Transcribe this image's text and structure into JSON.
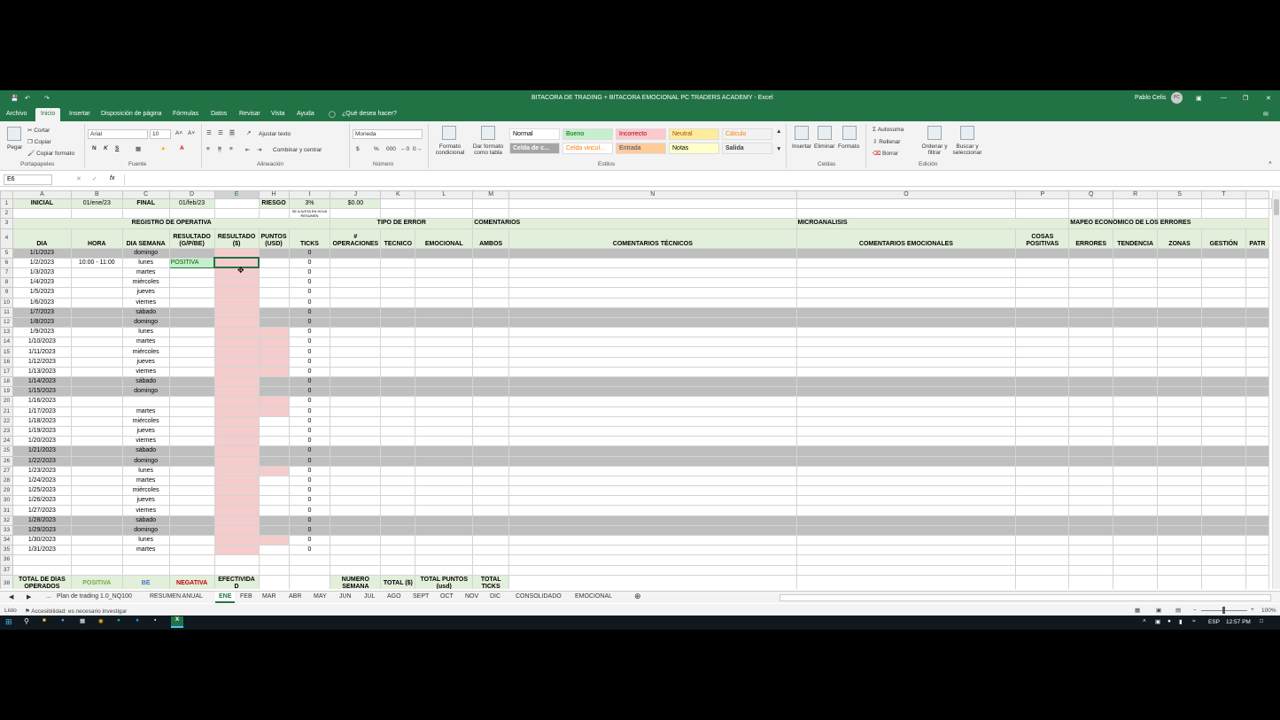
{
  "window": {
    "title": "BITACORA DE TRADING + BITACORA EMOCIONAL PC TRADERS ACADEMY - Excel",
    "user": "Pablo Celis",
    "user_initials": "PC"
  },
  "menu": [
    "Archivo",
    "Inicio",
    "Insertar",
    "Disposición de página",
    "Fórmulas",
    "Datos",
    "Revisar",
    "Vista",
    "Ayuda",
    "¿Qué desea hacer?"
  ],
  "ribbon": {
    "clipboard": {
      "paste": "Pegar",
      "cut": "Cortar",
      "copy": "Copiar",
      "format_painter": "Copiar formato",
      "label": "Portapapeles"
    },
    "font": {
      "name": "Arial",
      "size": "10",
      "bold": "N",
      "italic": "K",
      "underline": "S",
      "label": "Fuente"
    },
    "alignment": {
      "wrap": "Ajustar texto",
      "merge": "Combinar y centrar",
      "label": "Alineación"
    },
    "number": {
      "format": "Moneda",
      "label": "Número"
    },
    "styles": {
      "conditional": "Formato condicional",
      "table": "Dar formato como tabla",
      "label": "Estilos",
      "cells": [
        {
          "name": "Normal",
          "bg": "#ffffff",
          "fg": "#000000"
        },
        {
          "name": "Bueno",
          "bg": "#c6efce",
          "fg": "#006100"
        },
        {
          "name": "Incorrecto",
          "bg": "#ffc7ce",
          "fg": "#9c0006"
        },
        {
          "name": "Neutral",
          "bg": "#ffeb9c",
          "fg": "#9c5700"
        },
        {
          "name": "Cálculo",
          "bg": "#f2f2f2",
          "fg": "#fa7d00"
        },
        {
          "name": "Celda de c...",
          "bg": "#a5a5a5",
          "fg": "#ffffff"
        },
        {
          "name": "Celda vincul...",
          "bg": "#ffffff",
          "fg": "#fa7d00"
        },
        {
          "name": "Entrada",
          "bg": "#ffcc99",
          "fg": "#3f3f76"
        },
        {
          "name": "Notas",
          "bg": "#ffffcc",
          "fg": "#000000"
        },
        {
          "name": "Salida",
          "bg": "#f2f2f2",
          "fg": "#3f3f3f"
        }
      ]
    },
    "cells": {
      "insert": "Insertar",
      "delete": "Eliminar",
      "format": "Formato",
      "label": "Celdas"
    },
    "editing": {
      "autosum": "Autosuma",
      "fill": "Rellenar",
      "clear": "Borrar",
      "sort": "Ordenar y filtrar",
      "find": "Buscar y seleccionar",
      "label": "Edición"
    }
  },
  "namebox": "E6",
  "fx": "fx",
  "columns": [
    "A",
    "B",
    "C",
    "D",
    "E",
    "H",
    "I",
    "J",
    "K",
    "L",
    "M",
    "N",
    "O",
    "P",
    "Q",
    "R",
    "S",
    "T"
  ],
  "row1": {
    "inicial": "INICIAL",
    "inicial_val": "01/ene/23",
    "final": "FINAL",
    "final_val": "01/feb/23",
    "riesgo": "RIESGO",
    "riesgo_val": "3%",
    "riesgo_note": "SE AJUSTA EN HOJA RESUMEN",
    "capital": "$0.00"
  },
  "row3": {
    "registro": "REGISTRO DE OPERATIVA",
    "tipo_error": "TIPO DE ERROR",
    "comentarios": "COMENTARIOS",
    "micro": "MICROANALISIS",
    "mapeo": "MAPEO ECONÓMICO DE LOS ERRORES"
  },
  "headers": [
    "DIA",
    "HORA",
    "DIA SEMANA",
    "RESULTADO (G/P/BE)",
    "RESULTADO ($)",
    "PUNTOS (USD)",
    "TICKS",
    "# OPERACIONES",
    "TECNICO",
    "EMOCIONAL",
    "AMBOS",
    "COMENTARIOS TÉCNICOS",
    "COMENTARIOS EMOCIONALES",
    "COSAS POSITIVAS",
    "ERRORES",
    "TENDENCIA",
    "ZONAS",
    "GESTIÓN",
    "PATR"
  ],
  "rows": [
    {
      "n": "5",
      "date": "1/1/2023",
      "hora": "",
      "dia": "domingo",
      "res": "",
      "ticks": "0",
      "weekend": true
    },
    {
      "n": "6",
      "date": "1/2/2023",
      "hora": "10:00 - 11:00",
      "dia": "lunes",
      "res": "POSITIVA",
      "ticks": "0",
      "weekend": false
    },
    {
      "n": "7",
      "date": "1/3/2023",
      "hora": "",
      "dia": "martes",
      "res": "",
      "ticks": "0",
      "weekend": false
    },
    {
      "n": "8",
      "date": "1/4/2023",
      "hora": "",
      "dia": "miércoles",
      "res": "",
      "ticks": "0",
      "weekend": false
    },
    {
      "n": "9",
      "date": "1/5/2023",
      "hora": "",
      "dia": "jueves",
      "res": "",
      "ticks": "0",
      "weekend": false
    },
    {
      "n": "10",
      "date": "1/6/2023",
      "hora": "",
      "dia": "viernes",
      "res": "",
      "ticks": "0",
      "weekend": false
    },
    {
      "n": "11",
      "date": "1/7/2023",
      "hora": "",
      "dia": "sábado",
      "res": "",
      "ticks": "0",
      "weekend": true
    },
    {
      "n": "12",
      "date": "1/8/2023",
      "hora": "",
      "dia": "domingo",
      "res": "",
      "ticks": "0",
      "weekend": true
    },
    {
      "n": "13",
      "date": "1/9/2023",
      "hora": "",
      "dia": "lunes",
      "res": "",
      "ticks": "0",
      "weekend": false
    },
    {
      "n": "14",
      "date": "1/10/2023",
      "hora": "",
      "dia": "martes",
      "res": "",
      "ticks": "0",
      "weekend": false
    },
    {
      "n": "15",
      "date": "1/11/2023",
      "hora": "",
      "dia": "miércoles",
      "res": "",
      "ticks": "0",
      "weekend": false
    },
    {
      "n": "16",
      "date": "1/12/2023",
      "hora": "",
      "dia": "jueves",
      "res": "",
      "ticks": "0",
      "weekend": false
    },
    {
      "n": "17",
      "date": "1/13/2023",
      "hora": "",
      "dia": "viernes",
      "res": "",
      "ticks": "0",
      "weekend": false
    },
    {
      "n": "18",
      "date": "1/14/2023",
      "hora": "",
      "dia": "sábado",
      "res": "",
      "ticks": "0",
      "weekend": true
    },
    {
      "n": "19",
      "date": "1/15/2023",
      "hora": "",
      "dia": "domingo",
      "res": "",
      "ticks": "0",
      "weekend": true
    },
    {
      "n": "20",
      "date": "1/16/2023",
      "hora": "",
      "dia": "",
      "res": "",
      "ticks": "0",
      "weekend": false
    },
    {
      "n": "21",
      "date": "1/17/2023",
      "hora": "",
      "dia": "martes",
      "res": "",
      "ticks": "0",
      "weekend": false
    },
    {
      "n": "22",
      "date": "1/18/2023",
      "hora": "",
      "dia": "miércoles",
      "res": "",
      "ticks": "0",
      "weekend": false
    },
    {
      "n": "23",
      "date": "1/19/2023",
      "hora": "",
      "dia": "jueves",
      "res": "",
      "ticks": "0",
      "weekend": false
    },
    {
      "n": "24",
      "date": "1/20/2023",
      "hora": "",
      "dia": "viernes",
      "res": "",
      "ticks": "0",
      "weekend": false
    },
    {
      "n": "25",
      "date": "1/21/2023",
      "hora": "",
      "dia": "sábado",
      "res": "",
      "ticks": "0",
      "weekend": true
    },
    {
      "n": "26",
      "date": "1/22/2023",
      "hora": "",
      "dia": "domingo",
      "res": "",
      "ticks": "0",
      "weekend": true
    },
    {
      "n": "27",
      "date": "1/23/2023",
      "hora": "",
      "dia": "lunes",
      "res": "",
      "ticks": "0",
      "weekend": false
    },
    {
      "n": "28",
      "date": "1/24/2023",
      "hora": "",
      "dia": "martes",
      "res": "",
      "ticks": "0",
      "weekend": false
    },
    {
      "n": "29",
      "date": "1/25/2023",
      "hora": "",
      "dia": "miércoles",
      "res": "",
      "ticks": "0",
      "weekend": false
    },
    {
      "n": "30",
      "date": "1/26/2023",
      "hora": "",
      "dia": "jueves",
      "res": "",
      "ticks": "0",
      "weekend": false
    },
    {
      "n": "31",
      "date": "1/27/2023",
      "hora": "",
      "dia": "viernes",
      "res": "",
      "ticks": "0",
      "weekend": false
    },
    {
      "n": "32",
      "date": "1/28/2023",
      "hora": "",
      "dia": "sábado",
      "res": "",
      "ticks": "0",
      "weekend": true
    },
    {
      "n": "33",
      "date": "1/29/2023",
      "hora": "",
      "dia": "domingo",
      "res": "",
      "ticks": "0",
      "weekend": true
    },
    {
      "n": "34",
      "date": "1/30/2023",
      "hora": "",
      "dia": "lunes",
      "res": "",
      "ticks": "0",
      "weekend": false
    },
    {
      "n": "35",
      "date": "1/31/2023",
      "hora": "",
      "dia": "martes",
      "res": "",
      "ticks": "0",
      "weekend": false
    }
  ],
  "summary": {
    "total_dias": "TOTAL DE DÍAS OPERADOS",
    "positiva": "POSITIVA",
    "be": "BE",
    "negativa": "NEGATIVA",
    "efectividad": "EFECTIVIDA D",
    "numero_semana": "NÚMERO SEMANA",
    "total_usd": "TOTAL ($)",
    "total_puntos": "TOTAL PUNTOS (usd)",
    "total_ticks": "TOTAL TICKS"
  },
  "sheets": [
    "Plan de trading 1.0_NQ100",
    "RESUMEN ANUAL",
    "ENE",
    "FEB",
    "MAR",
    "ABR",
    "MAY",
    "JUN",
    "JUL",
    "AGO",
    "SEPT",
    "OCT",
    "NOV",
    "DIC",
    "CONSOLIDADO",
    "EMOCIONAL"
  ],
  "status": {
    "ready": "Listo",
    "accessibility": "Accesibilidad: es necesario investigar",
    "zoom": "100%"
  },
  "taskbar": {
    "lang": "ESP",
    "time": "12:57 PM"
  }
}
